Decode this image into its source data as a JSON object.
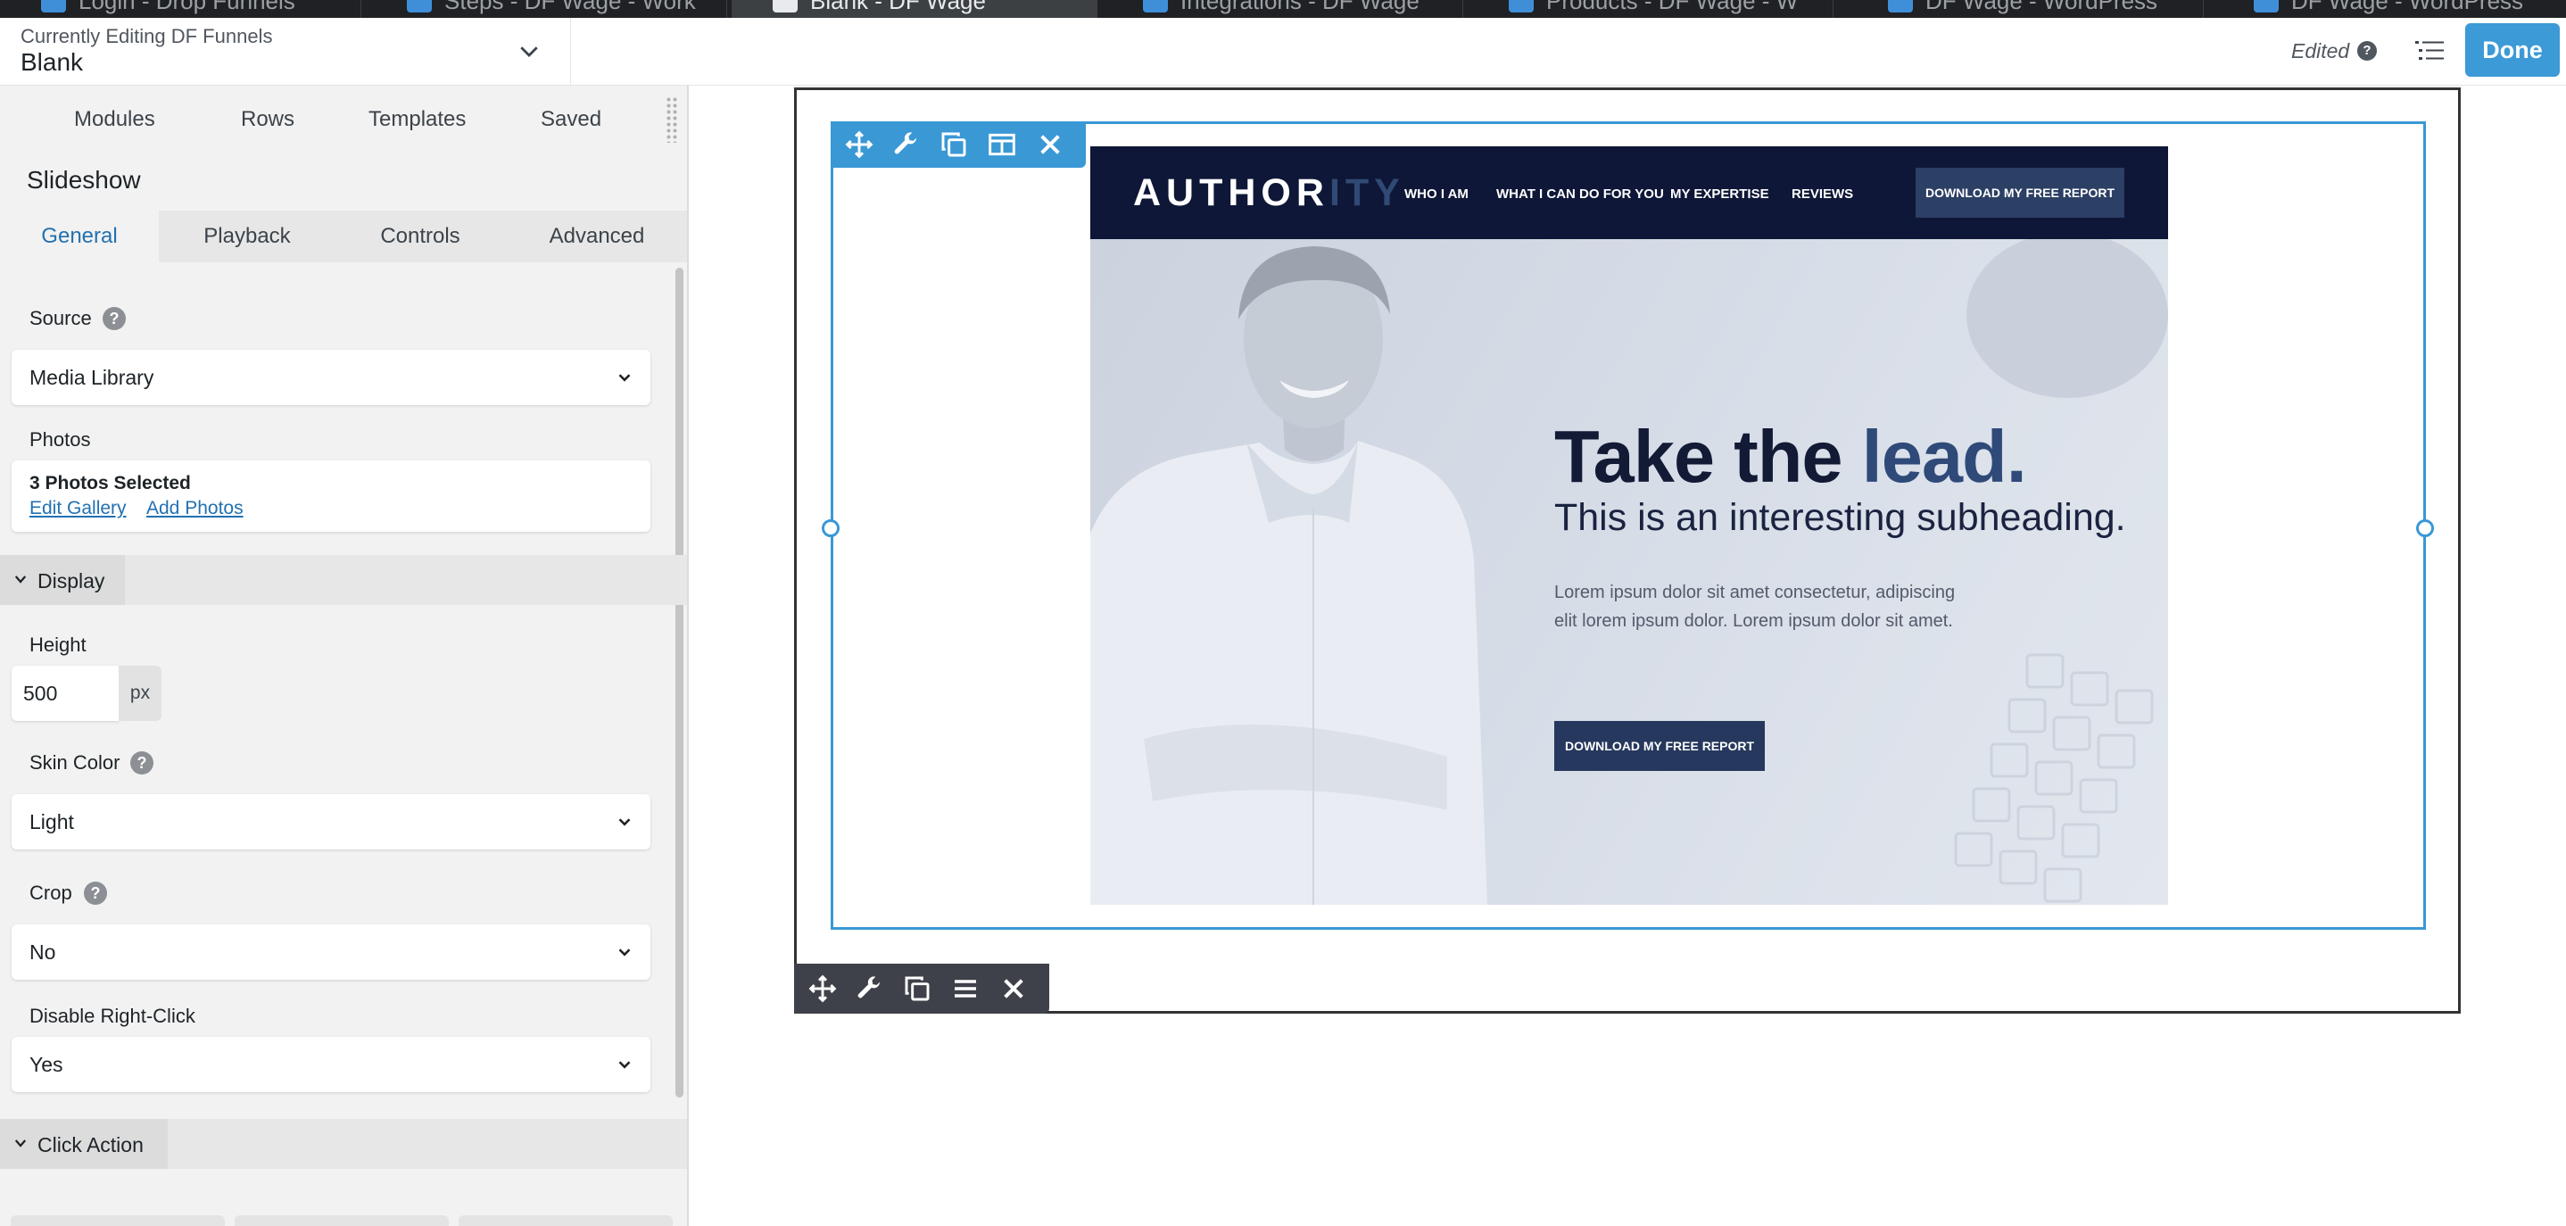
{
  "browser": {
    "tabs": [
      {
        "title": "Login - Drop Funnels"
      },
      {
        "title": "Steps - DF Wage - Work"
      },
      {
        "title": "Blank - DF Wage",
        "active": true
      },
      {
        "title": "Integrations - DF Wage"
      },
      {
        "title": "Products - DF Wage - W"
      },
      {
        "title": "DF Wage - WordPress"
      },
      {
        "title": "DF Wage - WordPress"
      }
    ]
  },
  "header": {
    "editing_label": "Currently Editing DF Funnels",
    "editing_title": "Blank",
    "edited_label": "Edited",
    "done_label": "Done"
  },
  "panel": {
    "tabs": [
      "Modules",
      "Rows",
      "Templates",
      "Saved"
    ],
    "module_title": "Slideshow",
    "settings_tabs": [
      "General",
      "Playback",
      "Controls",
      "Advanced"
    ],
    "active_settings_tab": "General",
    "source": {
      "label": "Source",
      "value": "Media Library"
    },
    "photos": {
      "label": "Photos",
      "count_text": "3 Photos Selected",
      "edit_link": "Edit Gallery",
      "add_link": "Add Photos"
    },
    "display_section": "Display",
    "height": {
      "label": "Height",
      "value": "500",
      "unit": "px"
    },
    "skin_color": {
      "label": "Skin Color",
      "value": "Light"
    },
    "crop": {
      "label": "Crop",
      "value": "No"
    },
    "disable_right_click": {
      "label": "Disable Right-Click",
      "value": "Yes"
    },
    "click_action_section": "Click Action"
  },
  "slide": {
    "logo_main": "AUTHOR",
    "logo_accent": "ITY",
    "nav": [
      "WHO I AM",
      "WHAT I CAN DO FOR YOU",
      "MY EXPERTISE",
      "REVIEWS"
    ],
    "nav_cta": "DOWNLOAD MY FREE REPORT",
    "heading_main": "Take the ",
    "heading_accent": "lead.",
    "subheading": "This is an interesting subheading.",
    "body": "Lorem ipsum dolor sit amet consectetur, adipiscing elit lorem ipsum dolor. Lorem ipsum dolor sit amet.",
    "cta": "DOWNLOAD MY FREE REPORT"
  },
  "colors": {
    "accent": "#3a98d5",
    "done_button": "#3c9ad6",
    "link": "#2271b1",
    "site_navy": "#0e1737"
  },
  "icons": {
    "module_toolbar": [
      "move-icon",
      "wrench-icon",
      "duplicate-icon",
      "columns-icon",
      "close-icon"
    ],
    "row_toolbar": [
      "move-icon",
      "wrench-icon",
      "duplicate-icon",
      "menu-icon",
      "close-icon"
    ]
  }
}
